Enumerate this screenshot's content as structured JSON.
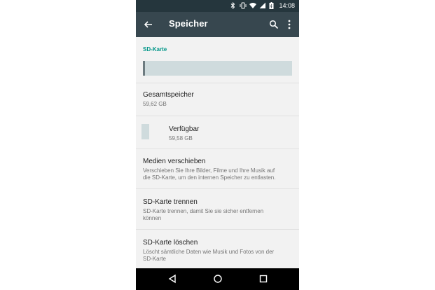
{
  "status_bar": {
    "time": "14:08",
    "icons": [
      "bluetooth-icon",
      "vibrate-icon",
      "wifi-icon",
      "signal-icon",
      "battery-icon"
    ]
  },
  "app_bar": {
    "title": "Speicher",
    "back_icon": "arrow-left-icon",
    "actions": [
      "search-icon",
      "more-vert-icon"
    ]
  },
  "section": {
    "header": "SD-Karte"
  },
  "usage": {
    "used_fraction": 0.01
  },
  "items": {
    "total": {
      "title": "Gesamtspeicher",
      "subtitle": "59,62 GB"
    },
    "available": {
      "title": "Verfügbar",
      "subtitle": "59,58 GB"
    },
    "move_media": {
      "title": "Medien verschieben",
      "subtitle_line1": "Verschieben Sie Ihre Bilder, Filme und Ihre Musik auf",
      "subtitle_line2": "die SD-Karte, um den internen Speicher zu entlasten."
    },
    "unmount": {
      "title": "SD-Karte trennen",
      "subtitle_line1": "SD-Karte trennen, damit Sie sie sicher entfernen",
      "subtitle_line2": "können"
    },
    "erase": {
      "title": "SD-Karte löschen",
      "subtitle_line1": "Löscht sämtliche Daten wie Musik und Fotos von der",
      "subtitle_line2": "SD-Karte"
    }
  },
  "nav_bar": {
    "buttons": [
      "back-triangle-icon",
      "home-circle-icon",
      "recents-square-icon"
    ]
  },
  "colors": {
    "status_bar": "#25363d",
    "app_bar": "#37474f",
    "accent": "#009688",
    "usage_bar": "#cfdbdd",
    "usage_fill": "#6d7b80"
  }
}
